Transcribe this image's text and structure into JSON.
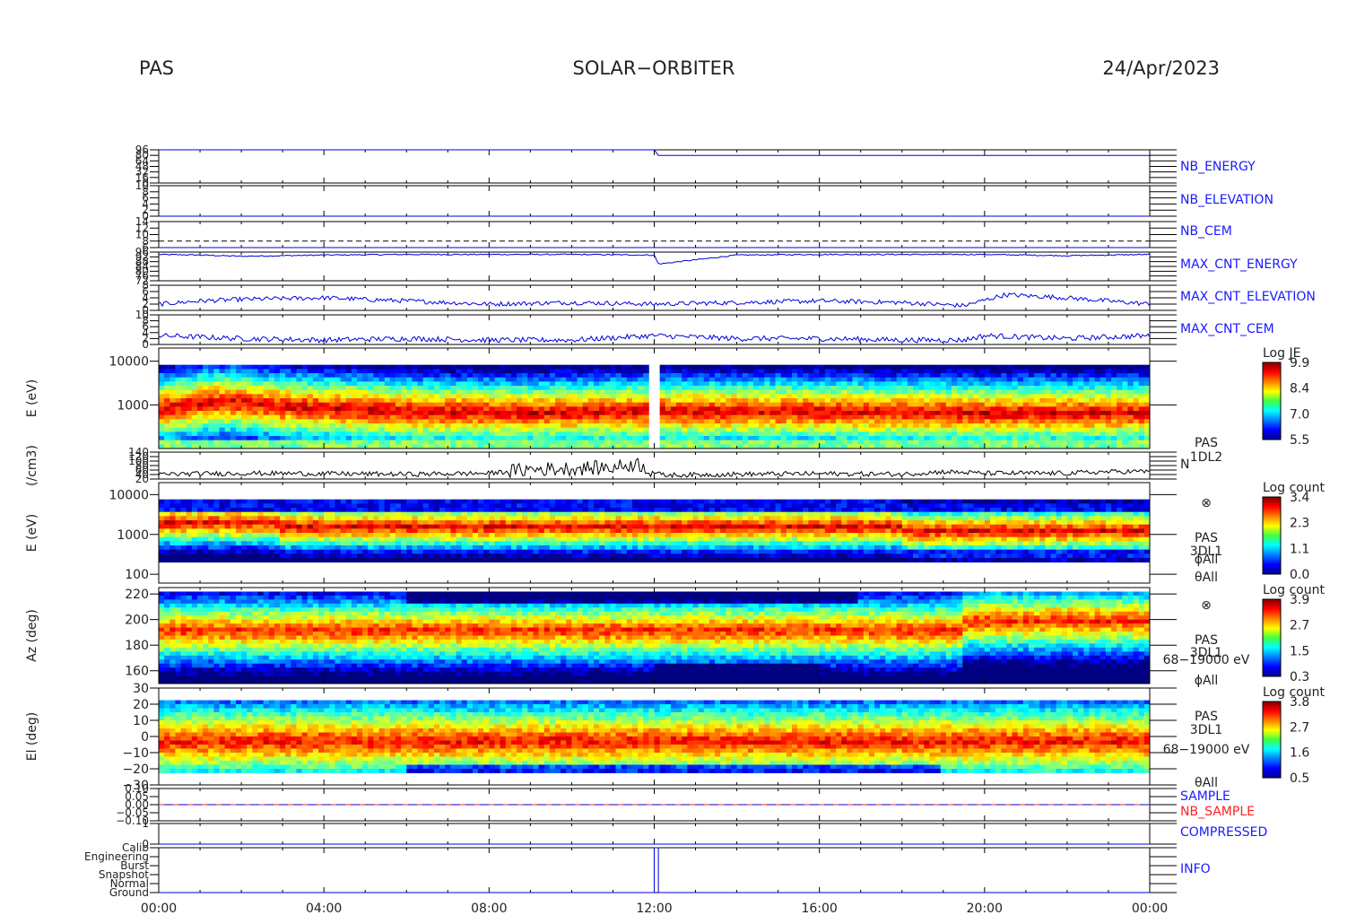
{
  "header": {
    "instrument": "PAS",
    "mission": "SOLAR−ORBITER",
    "date": "24/Apr/2023"
  },
  "colors": {
    "label_blue": "#1a1aff",
    "label_red": "#ff2020",
    "trace_blue": "#0000dd",
    "trace_black": "#000000"
  },
  "time_axis": {
    "ticks": [
      "00:00",
      "04:00",
      "08:00",
      "12:00",
      "16:00",
      "20:00",
      "00:00"
    ],
    "range_hours": [
      0,
      24
    ]
  },
  "chart_data": [
    {
      "type": "line",
      "panel": "nb-energy",
      "label": "NB_ENERGY",
      "yticks": [
        "96",
        "80",
        "64",
        "48",
        "32",
        "16",
        "0"
      ],
      "ylim": [
        0,
        96
      ],
      "x": [
        0,
        5.99,
        6.01,
        12.0,
        12.1,
        17.99,
        18.01,
        24
      ],
      "y": [
        96,
        96,
        96,
        96,
        80,
        80,
        80,
        80
      ]
    },
    {
      "type": "line",
      "panel": "nb-elevation",
      "label": "NB_ELEVATION",
      "yticks": [
        "10",
        "8",
        "6",
        "4",
        "2",
        "0"
      ],
      "ylim": [
        0,
        10
      ],
      "x": [
        0,
        24
      ],
      "y": [
        0,
        0
      ]
    },
    {
      "type": "line",
      "panel": "nb-cem",
      "label": "NB_CEM",
      "yticks": [
        "14",
        "12",
        "10",
        "8",
        "6"
      ],
      "ylim": [
        6,
        14
      ],
      "x": [
        0,
        24
      ],
      "y": [
        6,
        6
      ]
    },
    {
      "type": "line",
      "panel": "max-cnt-energy",
      "label": "MAX_CNT_ENERGY",
      "yticks": [
        "96",
        "92",
        "88",
        "84",
        "80",
        "76",
        "72"
      ],
      "ylim": [
        72,
        96
      ],
      "x": [
        0,
        1,
        2,
        4,
        6,
        8,
        10,
        12,
        12.1,
        14,
        16,
        18,
        20,
        22,
        24
      ],
      "y": [
        94,
        93.5,
        92.5,
        93.5,
        94,
        94,
        94,
        93.5,
        86,
        93.5,
        94,
        94,
        94,
        93,
        94
      ]
    },
    {
      "type": "line",
      "panel": "max-cnt-elevation",
      "label": "MAX_CNT_ELEVATION",
      "yticks": [
        "8",
        "6",
        "4",
        "2",
        "0"
      ],
      "ylim": [
        0,
        8
      ],
      "x": [
        0,
        1,
        2,
        4,
        6,
        8,
        10,
        12,
        14,
        16,
        18,
        19.5,
        20.5,
        22,
        24
      ],
      "y": [
        2,
        3,
        3.5,
        4,
        3,
        2,
        2.5,
        2,
        2.5,
        3,
        2.5,
        1.5,
        5,
        4,
        2
      ]
    },
    {
      "type": "line",
      "panel": "max-cnt-cem",
      "label": "MAX_CNT_CEM",
      "yticks": [
        "10",
        "8",
        "6",
        "4",
        "2",
        "0"
      ],
      "ylim": [
        0,
        10
      ],
      "x": [
        0,
        2,
        4,
        6,
        8,
        10,
        12,
        14,
        16,
        18,
        19.5,
        20,
        22,
        24
      ],
      "y": [
        3,
        2,
        1.5,
        2,
        1.5,
        1.5,
        3,
        2,
        2,
        1.5,
        1.5,
        3,
        2,
        3
      ]
    },
    {
      "type": "heatmap",
      "panel": "energy-spectrogram-1dl2",
      "ylabel": "E (eV)",
      "yticks": [
        "10000",
        "1000"
      ],
      "ylim": [
        100,
        20000
      ],
      "colorbar_title": "Log JE",
      "colorbar_ticks": [
        "9.9",
        "8.4",
        "7.0",
        "5.5"
      ],
      "side_labels": [
        "PAS",
        "1DL2"
      ],
      "peak_energy_eV": {
        "x": [
          0,
          1.5,
          3,
          6,
          9,
          11.5,
          12.5,
          16,
          20,
          24
        ],
        "y": [
          800,
          1200,
          900,
          700,
          650,
          700,
          700,
          700,
          650,
          650
        ]
      }
    },
    {
      "type": "line",
      "panel": "density",
      "ylabel": "(/cm3)",
      "label": "N",
      "yticks": [
        "140",
        "120",
        "100",
        "80",
        "60",
        "40",
        "20"
      ],
      "ylim": [
        0,
        140
      ],
      "x": [
        0,
        2,
        4,
        6,
        8,
        9,
        10,
        11,
        11.6,
        12,
        12.2,
        14,
        16,
        18,
        19,
        20,
        22,
        23,
        24
      ],
      "y": [
        25,
        30,
        28,
        25,
        30,
        50,
        55,
        60,
        80,
        35,
        20,
        25,
        28,
        25,
        38,
        30,
        30,
        38,
        40
      ]
    },
    {
      "type": "heatmap",
      "panel": "energy-spectrogram-3dl1",
      "ylabel": "E (eV)",
      "yticks": [
        "10000",
        "1000",
        "100"
      ],
      "ylim": [
        60,
        20000
      ],
      "colorbar_title": "Log count",
      "colorbar_ticks": [
        "3.4",
        "2.3",
        "1.1",
        "0.0"
      ],
      "side_labels": [
        "⊗",
        "PAS",
        "3DL1",
        "ϕAll",
        "θAll"
      ]
    },
    {
      "type": "heatmap",
      "panel": "azimuth-spectrogram",
      "ylabel": "Az (deg)",
      "yticks": [
        "220",
        "200",
        "180",
        "160"
      ],
      "ylim": [
        150,
        225
      ],
      "colorbar_title": "Log count",
      "colorbar_ticks": [
        "3.9",
        "2.7",
        "1.5",
        "0.3"
      ],
      "side_labels": [
        "⊗",
        "PAS",
        "3DL1",
        "68−19000 eV",
        "ϕAll"
      ]
    },
    {
      "type": "heatmap",
      "panel": "elevation-spectrogram",
      "ylabel": "El (deg)",
      "yticks": [
        "30",
        "20",
        "10",
        "0",
        "−10",
        "−20",
        "−30"
      ],
      "ylim": [
        -30,
        30
      ],
      "colorbar_title": "Log count",
      "colorbar_ticks": [
        "3.8",
        "2.7",
        "1.6",
        "0.5"
      ],
      "side_labels": [
        "PAS",
        "3DL1",
        "68−19000 eV",
        "θAll"
      ]
    },
    {
      "type": "line",
      "panel": "sample",
      "labels": [
        "SAMPLE",
        "NB_SAMPLE"
      ],
      "yticks": [
        "0.10",
        "0.05",
        "0.00",
        "−0.05",
        "−0.10"
      ],
      "ylim": [
        -0.1,
        0.1
      ],
      "x": [
        0,
        24
      ],
      "y": [
        0,
        0
      ]
    },
    {
      "type": "line",
      "panel": "compressed",
      "label": "COMPRESSED",
      "yticks": [
        "1",
        "0"
      ],
      "ylim": [
        0,
        1
      ],
      "x": [
        0,
        24
      ],
      "y": [
        0,
        0
      ]
    },
    {
      "type": "line",
      "panel": "info",
      "label": "INFO",
      "yticks": [
        "Calib",
        "Engineering",
        "Burst",
        "Snapshot",
        "Normal",
        "Ground"
      ],
      "ylim": [
        0,
        5
      ],
      "x": [
        0,
        12.0,
        12.0,
        12.1,
        12.1,
        24
      ],
      "y": [
        0,
        0,
        5,
        5,
        0,
        0
      ]
    }
  ]
}
